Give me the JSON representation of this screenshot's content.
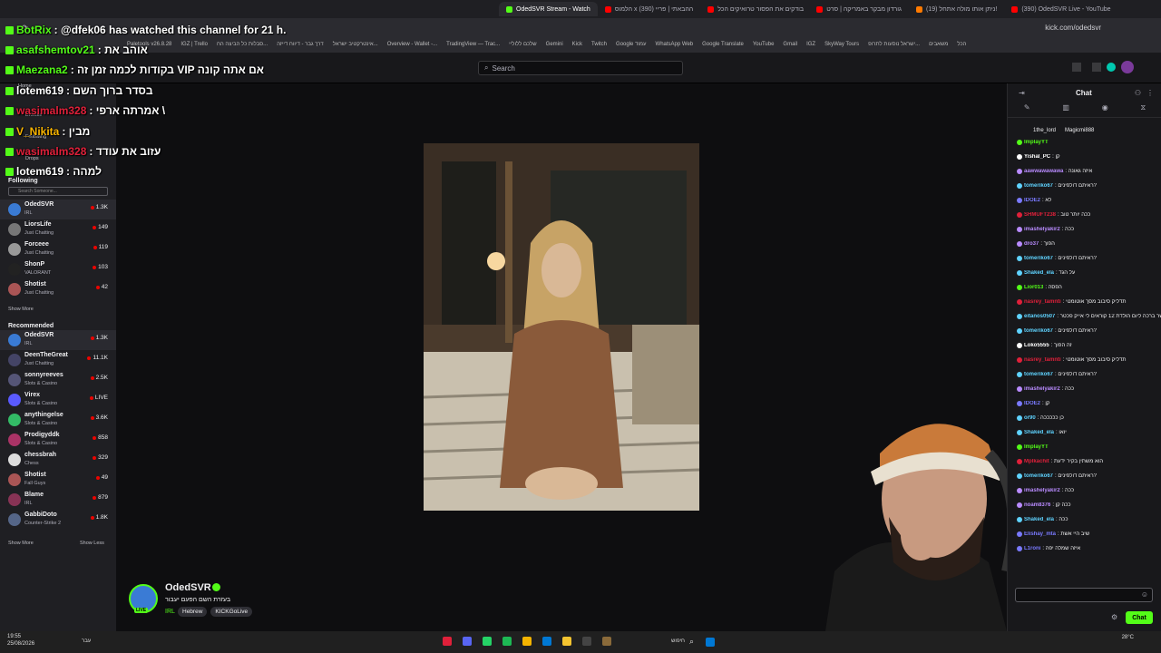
{
  "browser": {
    "tabs": [
      {
        "label": "OdedSVR Stream - Watch",
        "active": true,
        "color": "#53fc18"
      },
      {
        "label": "הלמוס x ההבאתי | פריי (390)",
        "active": false,
        "color": "#ff0000"
      },
      {
        "label": "בודקים את הפסור טרואיקים הכל",
        "active": false,
        "color": "#ff0000"
      },
      {
        "label": "גורדון מבקר באמריקה | סרט",
        "active": false,
        "color": "#ff0000"
      },
      {
        "label": "(19) ניתן אותו מולה אתחל!",
        "active": false,
        "color": "#ff7a00"
      },
      {
        "label": "(390) OdedSVR Live - YouTube",
        "active": false,
        "color": "#ff0000"
      }
    ],
    "url": "kick.com/odedsvr",
    "bookmarks": [
      "Paletools v26.8.28",
      "IGZ | Trello",
      "סבלות כל הביצה הח...",
      "דרך גבר - דיווח דייזה",
      "אינטרקטיב ישראל...",
      "Overview - Wallet -...",
      "TradingView — Trac...",
      "שלכם ללוליי",
      "Gemini",
      "Kick",
      "Twitch",
      "Google עמוד",
      "WhatsApp Web",
      "Google Translate",
      "YouTube",
      "Gmail",
      "IGZ",
      "SkyWay Tours",
      "ישראל נוסעות לתרופ...",
      "משאבים",
      "הכל"
    ]
  },
  "topbar": {
    "search_placeholder": "Search"
  },
  "overlay_chat": [
    {
      "user": "BotRix",
      "text": ": @dfek06 has watched this channel for 21 h.",
      "color": "#53fc18"
    },
    {
      "user": "asafshemtov21",
      "text": ": אוהב את",
      "color": "#53fc18"
    },
    {
      "user": "Maezana2",
      "text": ": בקודות לכמה זמן זה VIP אם אתה קונה",
      "color": "#53fc18"
    },
    {
      "user": "lotem619",
      "text": ": בסדר ברוך השם",
      "color": "#ffffff"
    },
    {
      "user": "wasimalm328",
      "text": ": אמרתה ארפי \\",
      "color": "#e0203a"
    },
    {
      "user": "V_Nikita",
      "text": ": מבין",
      "color": "#f8b400"
    },
    {
      "user": "wasimalm328",
      "text": ": עזוב את עודד",
      "color": "#e0203a"
    },
    {
      "user": "lotem619",
      "text": ": למהה",
      "color": "#ffffff"
    }
  ],
  "sidebar": {
    "following_header": "Following",
    "search_placeholder": "Search Someone...",
    "following": [
      {
        "name": "OdedSVR",
        "game": "IRL",
        "viewers": "1.3K",
        "color": "#3a7bd5"
      },
      {
        "name": "LiorsLife",
        "game": "Just Chatting",
        "viewers": "149",
        "color": "#777"
      },
      {
        "name": "Forceee",
        "game": "Just Chatting",
        "viewers": "119",
        "color": "#999"
      },
      {
        "name": "ShonP",
        "game": "VALORANT",
        "viewers": "103",
        "color": "#222"
      },
      {
        "name": "Shotist",
        "game": "Just Chatting",
        "viewers": "42",
        "color": "#a55"
      }
    ],
    "show_more_following": "Show More",
    "recommended_header": "Recommended",
    "recommended": [
      {
        "name": "OdedSVR",
        "game": "IRL",
        "viewers": "1.3K",
        "color": "#3a7bd5"
      },
      {
        "name": "DeenTheGreat",
        "game": "Just Chatting",
        "viewers": "11.1K",
        "color": "#446"
      },
      {
        "name": "sonnyreeves",
        "game": "Slots & Casino",
        "viewers": "2.5K",
        "color": "#557"
      },
      {
        "name": "Virex",
        "game": "Slots & Casino",
        "viewers": "LIVE",
        "color": "#5a5aff"
      },
      {
        "name": "anythingelse",
        "game": "Slots & Casino",
        "viewers": "3.6K",
        "color": "#3b6"
      },
      {
        "name": "Prodigyddk",
        "game": "Slots & Casino",
        "viewers": "858",
        "color": "#a36"
      },
      {
        "name": "chessbrah",
        "game": "Chess",
        "viewers": "329",
        "color": "#ddd"
      },
      {
        "name": "Shotist",
        "game": "Fall Guys",
        "viewers": "49",
        "color": "#a55"
      },
      {
        "name": "Blame",
        "game": "IRL",
        "viewers": "879",
        "color": "#835"
      },
      {
        "name": "GabbiDoto",
        "game": "Counter-Strike 2",
        "viewers": "1.8K",
        "color": "#568"
      }
    ],
    "show_more": "Show More",
    "show_less": "Show Less",
    "nav_following": "Following",
    "nav_browse": "Browse",
    "nav_drops": "Drops"
  },
  "channel": {
    "name": "OdedSVR",
    "title": "בעזרת השם הפעם יעבור",
    "category": "IRL",
    "tags": [
      "Hebrew",
      "KICKGoLive"
    ],
    "live_badge": "LIVE"
  },
  "chat": {
    "header": "Chat",
    "top_users": [
      "1the_lord",
      "Magicmi888"
    ],
    "messages": [
      {
        "user": "ImplayYT",
        "text": "",
        "color": "#53fc18"
      },
      {
        "user": "Yishal_PC",
        "text": ": קן",
        "color": "#ffffff"
      },
      {
        "user": "aawwawawawa",
        "text": ": איזה גאונה",
        "color": "#b98bff"
      },
      {
        "user": "tomeriko67",
        "text": ": ראיתם דולפינים?",
        "color": "#5fd3ff"
      },
      {
        "user": "IDOE2",
        "text": ": לא",
        "color": "#7a7aff"
      },
      {
        "user": "SHMUFT238",
        "text": ": ככה יותר טוב",
        "color": "#e0203a"
      },
      {
        "user": "imashelyakir2",
        "text": ": ככה",
        "color": "#b98bff"
      },
      {
        "user": "dro37",
        "text": ": הפוך",
        "color": "#b98bff"
      },
      {
        "user": "tomeriko67",
        "text": ": ראיתם דולפינים?",
        "color": "#5fd3ff"
      },
      {
        "user": "Shaked_ela",
        "text": ": על הגד",
        "color": "#5fd3ff"
      },
      {
        "user": "Lior013",
        "text": ": הפסה",
        "color": "#53fc18"
      },
      {
        "user": "nasrey_tamnti",
        "text": ": תדליק סיבוב מסך אוטומטי",
        "color": "#e0203a"
      },
      {
        "user": "eitanos0507",
        "text": ": אפשר ברכה ליום הולדת 12 קוראים לי אייק פכטר",
        "color": "#5fd3ff"
      },
      {
        "user": "tomeriko67",
        "text": ": ראיתם דולפינים?",
        "color": "#5fd3ff"
      },
      {
        "user": "Loko5555",
        "text": ": זה הפוך",
        "color": "#ffffff"
      },
      {
        "user": "nasrey_tamnti",
        "text": ": תדליק סיבוב מסך אוטומטי",
        "color": "#e0203a"
      },
      {
        "user": "tomeriko67",
        "text": ": ראיתם דולפינים?",
        "color": "#5fd3ff"
      },
      {
        "user": "imashelyakir2",
        "text": ": ככה",
        "color": "#b98bff"
      },
      {
        "user": "IDOE2",
        "text": ": קן",
        "color": "#7a7aff"
      },
      {
        "user": "or90",
        "text": ": כן כככככה",
        "color": "#5fd3ff"
      },
      {
        "user": "Shaked_ela",
        "text": ": יואו",
        "color": "#5fd3ff"
      },
      {
        "user": "ImplayYT",
        "text": "",
        "color": "#53fc18"
      },
      {
        "user": "Mplkachit",
        "text": ": הוא משתין בקיר ידעת",
        "color": "#e0203a"
      },
      {
        "user": "tomeriko67",
        "text": ": ראיתם דולפינים?",
        "color": "#5fd3ff"
      },
      {
        "user": "imashelyakir2",
        "text": ": ככה",
        "color": "#b98bff"
      },
      {
        "user": "noam8376",
        "text": ": ככה קן",
        "color": "#b98bff"
      },
      {
        "user": "Shaked_ela",
        "text": ": ככה",
        "color": "#5fd3ff"
      },
      {
        "user": "Elishay_mta",
        "text": ": שיב היי אשת",
        "color": "#7a7aff"
      },
      {
        "user": "L1roni",
        "text": ": איזה שמלה יפה",
        "color": "#7a7aff"
      }
    ],
    "send_label": "Chat"
  },
  "taskbar": {
    "time": "19:55",
    "date": "25/08/2026",
    "search_label": "חיפוש",
    "lang": "עבר",
    "weather": "28°C"
  },
  "colors": {
    "kick_green": "#53fc18",
    "bg": "#0e0e10",
    "panel": "#18181b"
  }
}
